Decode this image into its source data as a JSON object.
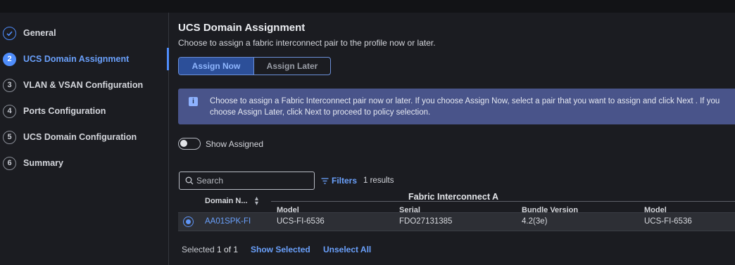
{
  "sidebar": {
    "steps": [
      {
        "num": "✓",
        "label": "General"
      },
      {
        "num": "2",
        "label": "UCS Domain Assignment"
      },
      {
        "num": "3",
        "label": "VLAN & VSAN Configuration"
      },
      {
        "num": "4",
        "label": "Ports Configuration"
      },
      {
        "num": "5",
        "label": "UCS Domain Configuration"
      },
      {
        "num": "6",
        "label": "Summary"
      }
    ],
    "active_index": 1
  },
  "main": {
    "title": "UCS Domain Assignment",
    "subtitle": "Choose to assign a fabric interconnect pair to the profile now or later.",
    "segmented": {
      "assign_now": "Assign Now",
      "assign_later": "Assign Later",
      "selected": "Assign Now"
    },
    "info": {
      "icon": "info-icon",
      "text": "Choose to assign a Fabric Interconnect pair now or later. If you choose Assign Now, select a pair that you want to assign and click Next . If you choose Assign Later, click Next to proceed to policy selection."
    },
    "toggle": {
      "label": "Show Assigned",
      "on": false
    },
    "search": {
      "placeholder": "Search",
      "value": ""
    },
    "filters_label": "Filters",
    "results": "1 results"
  },
  "table": {
    "group_title": "Fabric Interconnect A",
    "headers": {
      "domain": "Domain N...",
      "model": "Model",
      "serial": "Serial",
      "bundle": "Bundle Version",
      "model_b": "Model"
    },
    "rows": [
      {
        "selected": true,
        "domain": "AA01SPK-FI",
        "model": "UCS-FI-6536",
        "serial": "FDO27131385",
        "bundle": "4.2(3e)",
        "model_b": "UCS-FI-6536"
      }
    ]
  },
  "footer": {
    "selected_prefix": "Selected",
    "selected_count": "1 of 1",
    "show_selected": "Show Selected",
    "unselect_all": "Unselect All"
  },
  "colors": {
    "accent": "#4f8dfb",
    "info_bg": "#49548a",
    "background": "#1b1c21"
  }
}
